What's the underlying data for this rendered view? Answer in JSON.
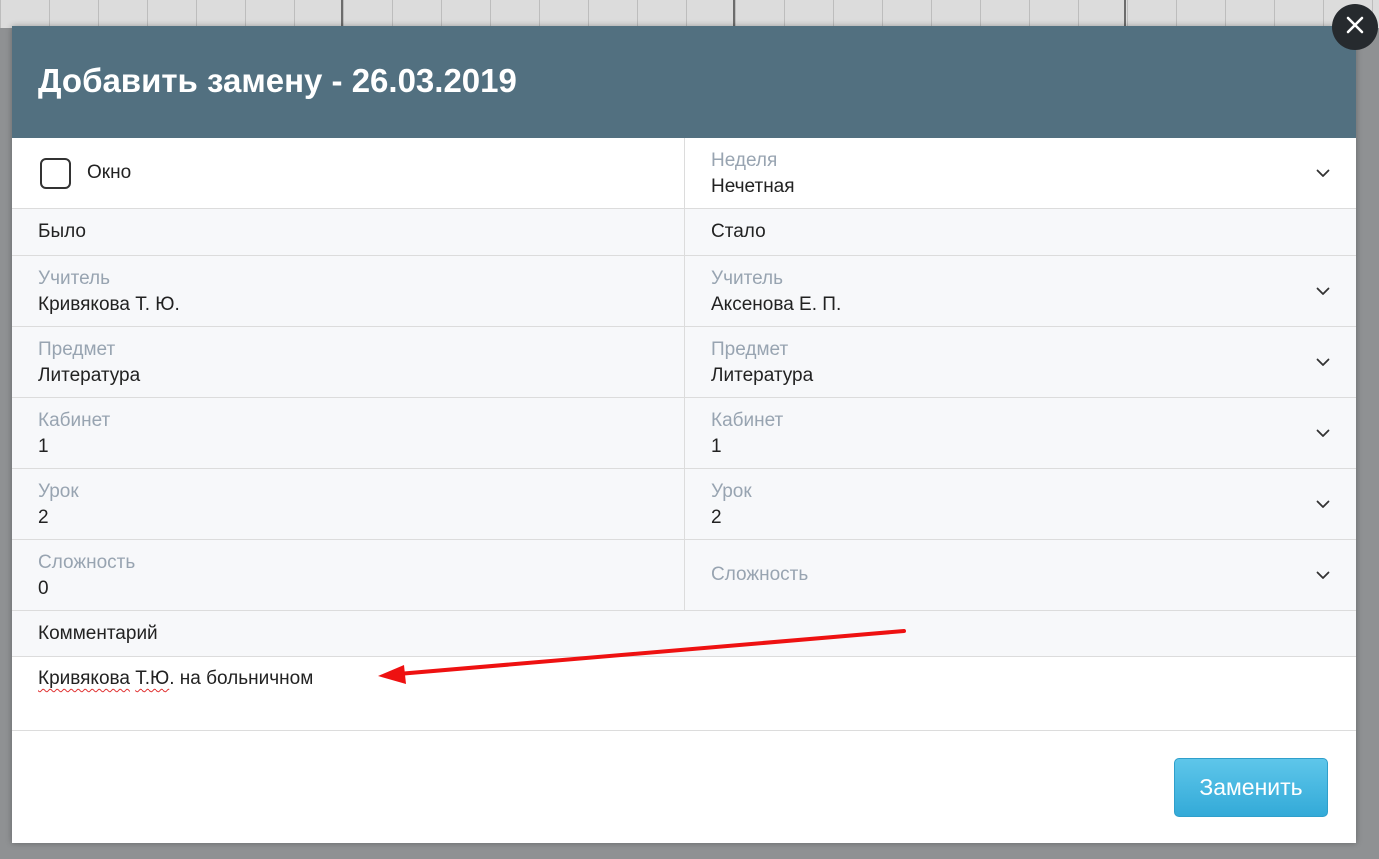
{
  "modal": {
    "title": "Добавить замену - 26.03.2019",
    "window_checkbox_label": "Окно",
    "week": {
      "label": "Неделя",
      "value": "Нечетная"
    },
    "was_title": "Было",
    "became_title": "Стало",
    "was": {
      "teacher": {
        "label": "Учитель",
        "value": "Кривякова Т. Ю."
      },
      "subject": {
        "label": "Предмет",
        "value": "Литература"
      },
      "room": {
        "label": "Кабинет",
        "value": "1"
      },
      "lesson": {
        "label": "Урок",
        "value": "2"
      },
      "difficulty": {
        "label": "Сложность",
        "value": "0"
      }
    },
    "became": {
      "teacher": {
        "label": "Учитель",
        "value": "Аксенова Е. П."
      },
      "subject": {
        "label": "Предмет",
        "value": "Литература"
      },
      "room": {
        "label": "Кабинет",
        "value": "1"
      },
      "lesson": {
        "label": "Урок",
        "value": "2"
      },
      "difficulty": {
        "label": "Сложность",
        "value": ""
      }
    },
    "comment_title": "Комментарий",
    "comment": {
      "word1": "Кривякова",
      "space": " ",
      "word2": "Т.Ю",
      "rest": ". на больничном"
    },
    "replace_button": "Заменить"
  },
  "colors": {
    "header_bg": "#527080",
    "button_bg": "#3fb4de",
    "label_grey": "#98a4b1",
    "annotation_arrow": "#ee1111"
  },
  "icons": {
    "close": "close-icon",
    "dropdown": "chevron-down-icon"
  }
}
